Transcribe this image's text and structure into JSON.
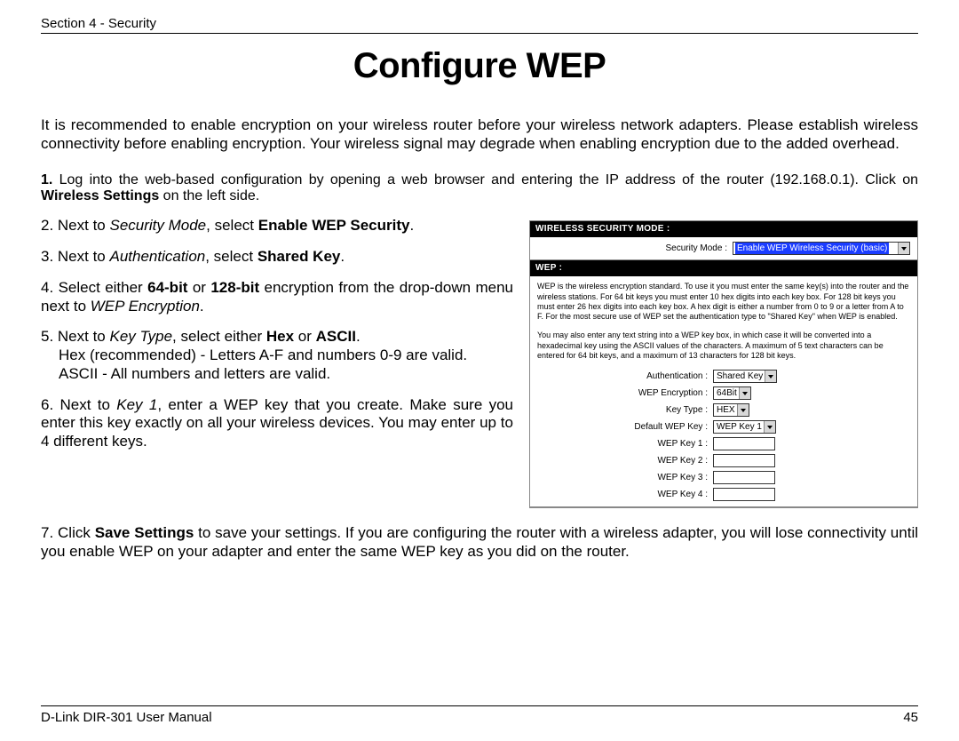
{
  "header": {
    "section": "Section 4 - Security"
  },
  "title": "Configure WEP",
  "intro": "It is recommended to enable encryption on your wireless router before your wireless network adapters. Please establish wireless connectivity before enabling encryption. Your wireless signal may degrade when enabling encryption due to the added overhead.",
  "steps": {
    "s1a": "1.",
    "s1b": " Log into the web-based configuration by opening a web browser and entering the IP address of the router (192.168.0.1). Click on ",
    "s1c": "Wireless Settings",
    "s1d": " on the left side.",
    "s2a": "2. Next to ",
    "s2b": "Security Mode",
    "s2c": ", select ",
    "s2d": "Enable WEP Security",
    "s2e": ".",
    "s3a": "3. Next to ",
    "s3b": "Authentication",
    "s3c": ", select ",
    "s3d": "Shared Key",
    "s3e": ".",
    "s4a": "4. Select either ",
    "s4b": "64-bit",
    "s4c": " or ",
    "s4d": "128-bit",
    "s4e": " encryption from the drop-down menu next to ",
    "s4f": "WEP Encryption",
    "s4g": ".",
    "s5a": "5. Next to ",
    "s5b": "Key Type",
    "s5c": ", select either ",
    "s5d": "Hex",
    "s5e": " or ",
    "s5f": "ASCII",
    "s5g": ".",
    "s5h": "Hex (recommended) - Letters A-F and numbers 0-9 are valid.",
    "s5i": "ASCII - All numbers and letters are valid.",
    "s6a": "6. Next to ",
    "s6b": "Key 1",
    "s6c": ", enter a WEP key that you create. Make sure you enter this key exactly on all your wireless devices. You may enter up to 4 different keys.",
    "s7a": "7. Click ",
    "s7b": "Save Settings",
    "s7c": " to save your settings. If you are configuring the router with a wireless adapter, you will lose connectivity until you enable WEP on your adapter and enter the same WEP key as you did on the router."
  },
  "screenshot": {
    "head1": "WIRELESS SECURITY MODE :",
    "sec_mode_label": "Security Mode :",
    "sec_mode_value": "Enable WEP Wireless Security (basic)",
    "head2": "WEP :",
    "desc1": "WEP is the wireless encryption standard. To use it you must enter the same key(s) into the router and the wireless stations. For 64 bit keys you must enter 10 hex digits into each key box. For 128 bit keys you must enter 26 hex digits into each key box. A hex digit is either a number from 0 to 9 or a letter from A to F. For the most secure use of WEP set the authentication type to \"Shared Key\" when WEP is enabled.",
    "desc2": "You may also enter any text string into a WEP key box, in which case it will be converted into a hexadecimal key using the ASCII values of the characters. A maximum of 5 text characters can be entered for 64 bit keys, and a maximum of 13 characters for 128 bit keys.",
    "auth_label": "Authentication :",
    "auth_value": "Shared Key",
    "enc_label": "WEP Encryption :",
    "enc_value": "64Bit",
    "keytype_label": "Key Type :",
    "keytype_value": "HEX",
    "defkey_label": "Default WEP Key :",
    "defkey_value": "WEP Key 1",
    "k1": "WEP Key 1 :",
    "k2": "WEP Key 2 :",
    "k3": "WEP Key 3 :",
    "k4": "WEP Key 4 :"
  },
  "footer": {
    "left": "D-Link DIR-301 User Manual",
    "right": "45"
  }
}
